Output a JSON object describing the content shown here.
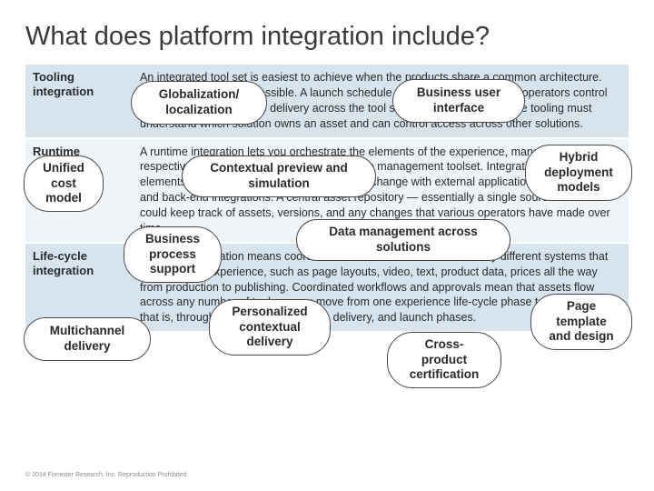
{
  "title": "What does platform integration include?",
  "rows": [
    {
      "label": "Tooling integration",
      "body": "An integrated tool set is easiest to achieve when the products share a common architecture. But that's typically not possible. A launch schedule and calendar has to give operators control and the ability to manage delivery across the tool set. Every user of the same tooling must understand which solution owns an asset and can control access across other solutions."
    },
    {
      "label": "Runtime integration",
      "body": "A runtime integration lets you orchestrate the elements of the experience, managed in their respective solutions, using a single experience management toolset. Integration between the elements enables communication and data exchange with external applications, data, services, and back-end integrations. A central asset repository — essentially a single source of truth — could keep track of assets, versions, and any changes that various operators have made over time."
    },
    {
      "label": "Life-cycle integration",
      "body": "Life-cycle integration means coordinated control of assets across many different systems that compose the experience, such as page layouts, video, text, product data, prices all the way from production to publishing. Coordinated workflows and approvals mean that assets flow across any number of tools as you move from one experience life-cycle phase to the next — that is, through the planning, creation, delivery, and launch phases."
    }
  ],
  "bubbles": {
    "globalization": "Globalization/\nlocalization",
    "business_user": "Business user\ninterface",
    "unified_cost": "Unified\ncost\nmodel",
    "contextual_preview": "Contextual preview and\nsimulation",
    "hybrid": "Hybrid\ndeployment\nmodels",
    "business_process": "Business\nprocess\nsupport",
    "data_mgmt": "Data management across\nsolutions",
    "multichannel": "Multichannel\ndelivery",
    "personalized": "Personalized\ncontextual\ndelivery",
    "cross_product": "Cross-\nproduct\ncertification",
    "page_template": "Page\ntemplate\nand design"
  },
  "footer": "© 2014 Forrester Research, Inc. Reproduction Prohibited"
}
